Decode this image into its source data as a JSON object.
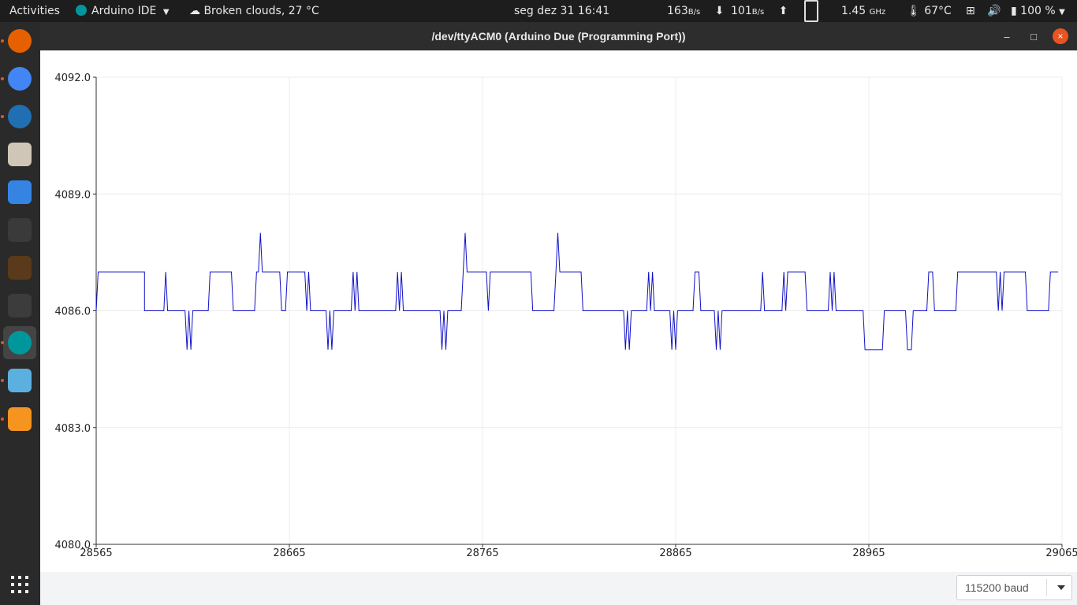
{
  "topbar": {
    "activities": "Activities",
    "app_name": "Arduino IDE",
    "weather": "Broken clouds, 27 °C",
    "clock": "seg dez 31  16:41",
    "net_down_value": "163",
    "net_down_unit": "B/s",
    "net_up_value": "101",
    "net_up_unit": "B/s",
    "cpu_freq": "1.45",
    "cpu_freq_unit": "GHz",
    "temperature": "67°C",
    "battery": "100 %"
  },
  "dock": {
    "items": [
      {
        "icon": "firefox-icon",
        "color": "#e66000"
      },
      {
        "icon": "chrome-icon",
        "color": "#4285f4"
      },
      {
        "icon": "thunderbird-icon",
        "color": "#1f6fb2"
      },
      {
        "icon": "files-icon",
        "color": "#cfc6b8"
      },
      {
        "icon": "text-editor-icon",
        "color": "#3584e4"
      },
      {
        "icon": "terminal-icon",
        "color": "#3a3a3a"
      },
      {
        "icon": "equalizer-icon",
        "color": "#5a3a1a"
      },
      {
        "icon": "system-monitor-icon",
        "color": "#3c3c3c"
      },
      {
        "icon": "arduino-icon",
        "color": "#00979c"
      },
      {
        "icon": "image-viewer-icon",
        "color": "#5bb0e0"
      },
      {
        "icon": "pdf-icon",
        "color": "#f5941f"
      }
    ]
  },
  "window": {
    "title": "/dev/ttyACM0 (Arduino Due (Programming Port))",
    "minimize": "–",
    "maximize": "□",
    "close": "×"
  },
  "baud": {
    "selected": "115200 baud"
  },
  "chart_data": {
    "type": "line",
    "yticks": [
      "4092.0",
      "4089.0",
      "4086.0",
      "4083.0",
      "4080.0"
    ],
    "ytick_values": [
      4092,
      4089,
      4086,
      4083,
      4080
    ],
    "ylim": [
      4080,
      4092
    ],
    "xticks": [
      "28565",
      "28665",
      "28765",
      "28865",
      "28965",
      "29065"
    ],
    "xtick_values": [
      28565,
      28665,
      28765,
      28865,
      28965,
      29065
    ],
    "xlim": [
      28565,
      29065
    ],
    "grid": true,
    "series": [
      {
        "color": "#1010c8",
        "points": [
          [
            28565,
            4086
          ],
          [
            28566,
            4087
          ],
          [
            28590,
            4087
          ],
          [
            28590,
            4086
          ],
          [
            28600,
            4086
          ],
          [
            28601,
            4087
          ],
          [
            28602,
            4086
          ],
          [
            28611,
            4086
          ],
          [
            28612,
            4085
          ],
          [
            28613,
            4086
          ],
          [
            28614,
            4085
          ],
          [
            28615,
            4086
          ],
          [
            28623,
            4086
          ],
          [
            28624,
            4087
          ],
          [
            28635,
            4087
          ],
          [
            28636,
            4086
          ],
          [
            28647,
            4086
          ],
          [
            28648,
            4087
          ],
          [
            28649,
            4087
          ],
          [
            28650,
            4088
          ],
          [
            28651,
            4087
          ],
          [
            28660,
            4087
          ],
          [
            28661,
            4086
          ],
          [
            28663,
            4086
          ],
          [
            28664,
            4087
          ],
          [
            28673,
            4087
          ],
          [
            28674,
            4086
          ],
          [
            28675,
            4087
          ],
          [
            28676,
            4086
          ],
          [
            28684,
            4086
          ],
          [
            28685,
            4085
          ],
          [
            28686,
            4086
          ],
          [
            28687,
            4085
          ],
          [
            28688,
            4086
          ],
          [
            28697,
            4086
          ],
          [
            28698,
            4087
          ],
          [
            28699,
            4086
          ],
          [
            28700,
            4087
          ],
          [
            28701,
            4086
          ],
          [
            28720,
            4086
          ],
          [
            28721,
            4087
          ],
          [
            28722,
            4086
          ],
          [
            28723,
            4087
          ],
          [
            28724,
            4086
          ],
          [
            28743,
            4086
          ],
          [
            28744,
            4085
          ],
          [
            28745,
            4086
          ],
          [
            28746,
            4085
          ],
          [
            28747,
            4086
          ],
          [
            28754,
            4086
          ],
          [
            28755,
            4087
          ],
          [
            28756,
            4088
          ],
          [
            28757,
            4087
          ],
          [
            28767,
            4087
          ],
          [
            28768,
            4086
          ],
          [
            28769,
            4087
          ],
          [
            28790,
            4087
          ],
          [
            28791,
            4086
          ],
          [
            28802,
            4086
          ],
          [
            28803,
            4087
          ],
          [
            28804,
            4088
          ],
          [
            28805,
            4087
          ],
          [
            28816,
            4087
          ],
          [
            28817,
            4086
          ],
          [
            28838,
            4086
          ],
          [
            28839,
            4085
          ],
          [
            28840,
            4086
          ],
          [
            28841,
            4085
          ],
          [
            28842,
            4086
          ],
          [
            28850,
            4086
          ],
          [
            28851,
            4087
          ],
          [
            28852,
            4086
          ],
          [
            28853,
            4087
          ],
          [
            28854,
            4086
          ],
          [
            28862,
            4086
          ],
          [
            28863,
            4085
          ],
          [
            28864,
            4086
          ],
          [
            28865,
            4085
          ],
          [
            28866,
            4086
          ],
          [
            28874,
            4086
          ],
          [
            28875,
            4087
          ],
          [
            28877,
            4087
          ],
          [
            28878,
            4086
          ],
          [
            28885,
            4086
          ],
          [
            28886,
            4085
          ],
          [
            28887,
            4086
          ],
          [
            28888,
            4085
          ],
          [
            28889,
            4086
          ],
          [
            28909,
            4086
          ],
          [
            28910,
            4087
          ],
          [
            28911,
            4086
          ],
          [
            28920,
            4086
          ],
          [
            28921,
            4087
          ],
          [
            28922,
            4086
          ],
          [
            28923,
            4087
          ],
          [
            28932,
            4087
          ],
          [
            28933,
            4086
          ],
          [
            28944,
            4086
          ],
          [
            28945,
            4087
          ],
          [
            28946,
            4086
          ],
          [
            28947,
            4087
          ],
          [
            28948,
            4086
          ],
          [
            28962,
            4086
          ],
          [
            28963,
            4085
          ],
          [
            28972,
            4085
          ],
          [
            28973,
            4086
          ],
          [
            28984,
            4086
          ],
          [
            28985,
            4085
          ],
          [
            28987,
            4085
          ],
          [
            28988,
            4086
          ],
          [
            28995,
            4086
          ],
          [
            28996,
            4087
          ],
          [
            28998,
            4087
          ],
          [
            28999,
            4086
          ],
          [
            29010,
            4086
          ],
          [
            29011,
            4087
          ],
          [
            29031,
            4087
          ],
          [
            29032,
            4086
          ],
          [
            29033,
            4087
          ],
          [
            29034,
            4086
          ],
          [
            29035,
            4087
          ],
          [
            29046,
            4087
          ],
          [
            29047,
            4086
          ],
          [
            29058,
            4086
          ],
          [
            29059,
            4087
          ],
          [
            29063,
            4087
          ]
        ]
      }
    ]
  }
}
